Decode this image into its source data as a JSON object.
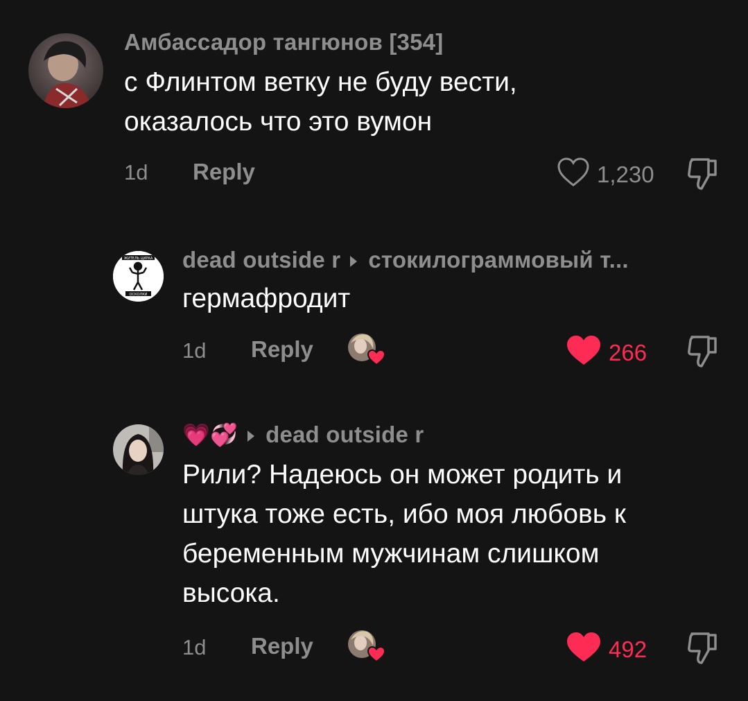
{
  "comments": [
    {
      "username": "Амбассадор тангюнов [354]",
      "text_line1": "с Флинтом ветку не буду вести,",
      "text_line2": "оказалось что это вумон",
      "time": "1d",
      "reply_label": "Reply",
      "likes": "1,230",
      "liked": false
    },
    {
      "username": "dead outside r",
      "reply_to": "стокилограммовый т...",
      "avatar_text_top": "ЖИТЕЛЬ ЦИРКА",
      "avatar_text_bottom": "ОСКОЛКИ",
      "text_line1": "гермафродит",
      "time": "1d",
      "reply_label": "Reply",
      "likes": "266",
      "liked": true
    },
    {
      "username_emojis": "💗💞",
      "reply_to": "dead outside r",
      "text_line1": "Рили? Надеюсь он может родить и",
      "text_line2": "штука тоже есть, ибо моя любовь к",
      "text_line3": "беременным мужчинам слишком",
      "text_line4": "высока.",
      "time": "1d",
      "reply_label": "Reply",
      "likes": "492",
      "liked": true
    }
  ],
  "colors": {
    "background": "#141414",
    "muted": "#8e8e8e",
    "like_red": "#fe2c55",
    "text": "#ffffff"
  },
  "icons": {
    "like": "heart-outline-icon",
    "liked": "heart-filled-icon",
    "dislike": "thumbs-down-icon",
    "creator_liked": "creator-avatar-heart-icon"
  }
}
